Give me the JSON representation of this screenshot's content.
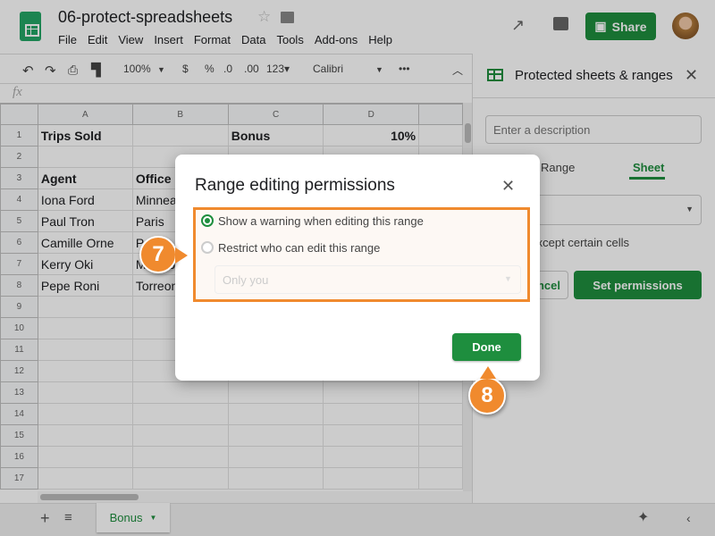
{
  "app": {
    "doc_title": "06-protect-spreadsheets",
    "menu": [
      "File",
      "Edit",
      "View",
      "Insert",
      "Format",
      "Data",
      "Tools",
      "Add-ons",
      "Help"
    ],
    "share_label": "Share"
  },
  "toolbar": {
    "zoom": "100%",
    "currency": "$",
    "percent": "%",
    "dec_less": ".0",
    "dec_more": ".00",
    "number_format": "123▾",
    "font": "Calibri",
    "more": "•••"
  },
  "formula_bar": {
    "fx": "fx"
  },
  "grid": {
    "columns": [
      "A",
      "B",
      "C",
      "D",
      ""
    ],
    "rows": [
      [
        "1",
        "Trips Sold",
        "",
        "Bonus",
        "10%",
        ""
      ],
      [
        "2",
        "",
        "",
        "",
        "",
        ""
      ],
      [
        "3",
        "Agent",
        "Office",
        "",
        "",
        ""
      ],
      [
        "4",
        "Iona Ford",
        "Minneapolis",
        "",
        "",
        ""
      ],
      [
        "5",
        "Paul Tron",
        "Paris",
        "",
        "",
        ""
      ],
      [
        "6",
        "Camille Orne",
        "Paris",
        "",
        "",
        ""
      ],
      [
        "7",
        "Kerry Oki",
        "Mexico City",
        "",
        "",
        ""
      ],
      [
        "8",
        "Pepe Roni",
        "Torreon",
        "",
        "",
        ""
      ],
      [
        "9",
        "",
        "",
        "",
        "",
        ""
      ],
      [
        "10",
        "",
        "",
        "",
        "",
        ""
      ],
      [
        "11",
        "",
        "",
        "",
        "",
        ""
      ],
      [
        "12",
        "",
        "",
        "",
        "",
        ""
      ],
      [
        "13",
        "",
        "",
        "",
        "",
        ""
      ],
      [
        "14",
        "",
        "",
        "",
        "",
        ""
      ],
      [
        "15",
        "",
        "",
        "",
        "",
        ""
      ],
      [
        "16",
        "",
        "",
        "",
        "",
        ""
      ],
      [
        "17",
        "",
        "",
        "",
        "",
        ""
      ]
    ]
  },
  "sheet_tab": {
    "label": "Bonus"
  },
  "panel": {
    "title": "Protected sheets & ranges",
    "description_placeholder": "Enter a description",
    "tab_range": "Range",
    "tab_sheet": "Sheet",
    "except_label": "Except certain cells",
    "cancel_label": "Cancel",
    "set_permissions_label": "Set permissions"
  },
  "dialog": {
    "title": "Range editing permissions",
    "option_warning": "Show a warning when editing this range",
    "option_restrict": "Restrict who can edit this range",
    "selected_option": "warning",
    "restrict_select": "Only you",
    "done_label": "Done"
  },
  "callouts": {
    "step7": "7",
    "step8": "8"
  },
  "colors": {
    "accent": "#1e8e3e",
    "callout": "#f08a2e"
  }
}
